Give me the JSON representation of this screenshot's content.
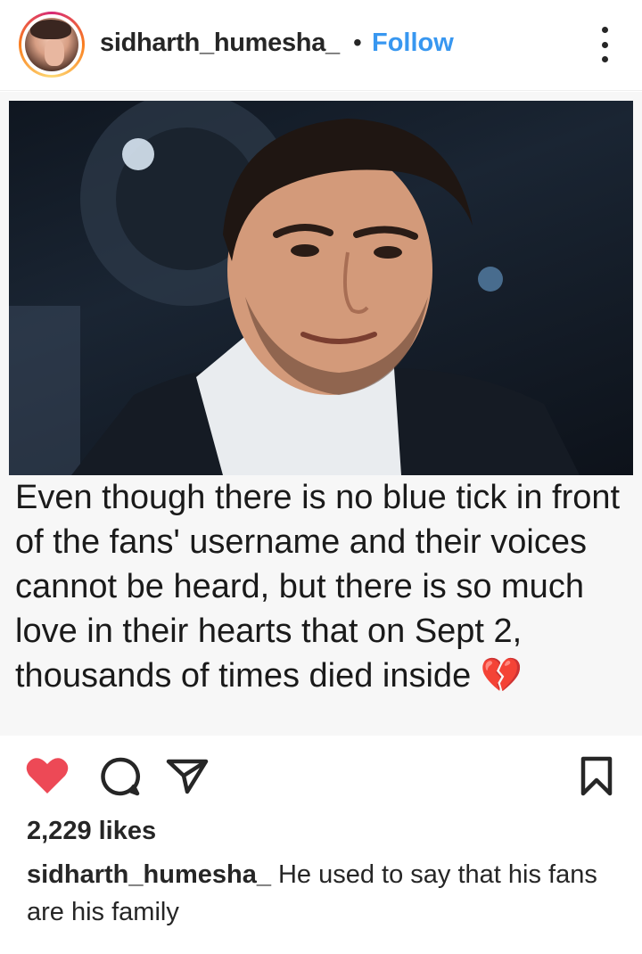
{
  "header": {
    "username": "sidharth_humesha_",
    "separator": "•",
    "follow_label": "Follow"
  },
  "post": {
    "overlay_text": "Even though there is no blue tick in front of the fans' username and their voices cannot be heard, but there is so much love in their hearts that on Sept 2, thousands of times died inside 💔"
  },
  "actions": {
    "liked": true,
    "like_color": "#ed4956"
  },
  "likes": {
    "count_text": "2,229 likes"
  },
  "caption": {
    "username": "sidharth_humesha_",
    "text": "He used to say that his fans are his family"
  },
  "colors": {
    "follow": "#3897f0",
    "text": "#262626"
  }
}
